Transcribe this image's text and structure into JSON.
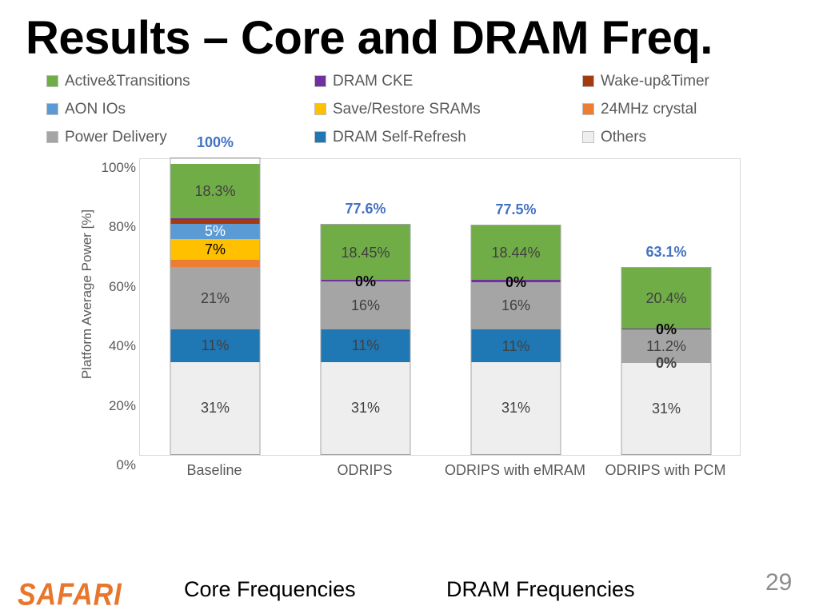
{
  "slide": {
    "title": "Results – Core and DRAM Freq.",
    "page_number": "29",
    "logo_text": "SAFARI",
    "bottom_captions": [
      "Core Frequencies",
      "DRAM Frequencies"
    ]
  },
  "colors": {
    "active_transitions": "#70ad47",
    "dram_cke": "#7030a0",
    "wake_up_timer": "#a53a10",
    "aon_ios": "#5b9bd5",
    "save_restore_srams": "#ffc000",
    "crystal_24mhz": "#ed7d31",
    "power_delivery": "#a5a5a5",
    "dram_self_refresh": "#1f77b4",
    "others": "#eeeeee",
    "total_label": "#4472c4",
    "axis_text": "#595959"
  },
  "legend": {
    "items": [
      {
        "label": "Active&Transitions",
        "color": "#70ad47"
      },
      {
        "label": "DRAM CKE",
        "color": "#7030a0"
      },
      {
        "label": "Wake-up&Timer",
        "color": "#a53a10"
      },
      {
        "label": "AON IOs",
        "color": "#5b9bd5"
      },
      {
        "label": "Save/Restore SRAMs",
        "color": "#ffc000"
      },
      {
        "label": "24MHz crystal",
        "color": "#ed7d31"
      },
      {
        "label": "Power Delivery",
        "color": "#a5a5a5"
      },
      {
        "label": "DRAM Self-Refresh",
        "color": "#1f77b4"
      },
      {
        "label": "Others",
        "color": "#eeeeee"
      }
    ]
  },
  "chart_data": {
    "type": "bar",
    "subtype": "stacked-column",
    "title": "",
    "xlabel": "",
    "ylabel": "Platform Average Power [%]",
    "ylim": [
      0,
      100
    ],
    "yticks": [
      "0%",
      "20%",
      "40%",
      "60%",
      "80%",
      "100%"
    ],
    "ytick_values": [
      0,
      20,
      40,
      60,
      80,
      100
    ],
    "grid": false,
    "legend_position": "top",
    "categories": [
      "Baseline",
      "ODRIPS",
      "ODRIPS with eMRAM",
      "ODRIPS with PCM"
    ],
    "totals": [
      "100%",
      "77.6%",
      "77.5%",
      "63.1%"
    ],
    "total_values": [
      100,
      77.6,
      77.5,
      63.1
    ],
    "series": [
      {
        "name": "Others",
        "color": "#eeeeee",
        "values": [
          31,
          31,
          31,
          31
        ],
        "labels": [
          "31%",
          "31%",
          "31%",
          "31%"
        ],
        "label_colors": [
          "#404040",
          "#404040",
          "#404040",
          "#404040"
        ]
      },
      {
        "name": "DRAM Self-Refresh",
        "color": "#1f77b4",
        "values": [
          11,
          11,
          11,
          0
        ],
        "labels": [
          "11%",
          "11%",
          "11%",
          "0%"
        ],
        "label_colors": [
          "#404040",
          "#404040",
          "#404040",
          "#404040"
        ]
      },
      {
        "name": "Power Delivery",
        "color": "#a5a5a5",
        "values": [
          21,
          16,
          16,
          11.2
        ],
        "labels": [
          "21%",
          "16%",
          "16%",
          "11.2%"
        ],
        "label_colors": [
          "#404040",
          "#404040",
          "#404040",
          "#404040"
        ]
      },
      {
        "name": "24MHz crystal",
        "color": "#ed7d31",
        "values": [
          2.4,
          0,
          0,
          0
        ],
        "labels": [
          "",
          "0%",
          "0%",
          "0%"
        ],
        "label_colors": [
          "#ffffff",
          "#ffffff",
          "#ffffff",
          "#ffffff"
        ]
      },
      {
        "name": "Save/Restore SRAMs",
        "color": "#ffc000",
        "values": [
          7,
          0,
          0,
          0
        ],
        "labels": [
          "7%",
          "",
          "",
          ""
        ],
        "label_colors": [
          "#000000",
          "#000000",
          "#000000",
          "#000000"
        ]
      },
      {
        "name": "AON IOs",
        "color": "#5b9bd5",
        "values": [
          5,
          0,
          0,
          0
        ],
        "labels": [
          "5%",
          "",
          "",
          ""
        ],
        "label_colors": [
          "#ffffff",
          "#ffffff",
          "#ffffff",
          "#ffffff"
        ]
      },
      {
        "name": "Wake-up&Timer",
        "color": "#a53a10",
        "values": [
          1.3,
          0,
          0,
          0
        ],
        "labels": [
          "",
          "0%",
          "0%",
          "0%"
        ],
        "label_colors": [
          "#000000",
          "#000000",
          "#000000",
          "#000000"
        ]
      },
      {
        "name": "DRAM CKE",
        "color": "#7030a0",
        "values": [
          0.7,
          0.7,
          0.7,
          0.5
        ],
        "labels": [
          "",
          "",
          "",
          ""
        ],
        "label_colors": [
          "#ffffff",
          "#ffffff",
          "#ffffff",
          "#ffffff"
        ]
      },
      {
        "name": "Active&Transitions",
        "color": "#70ad47",
        "values": [
          18.3,
          18.45,
          18.44,
          20.4
        ],
        "labels": [
          "18.3%",
          "18.45%",
          "18.44%",
          "20.4%"
        ],
        "label_colors": [
          "#404040",
          "#404040",
          "#404040",
          "#404040"
        ]
      }
    ]
  }
}
